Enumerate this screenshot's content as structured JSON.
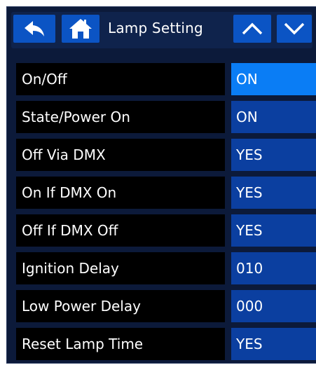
{
  "header": {
    "title": "Lamp Setting",
    "icons": {
      "back": "back-arrow-icon",
      "home": "home-icon",
      "up": "chevron-up-icon",
      "down": "chevron-down-icon"
    }
  },
  "colors": {
    "background": "#0c1a3a",
    "button": "#0b54c4",
    "value_cell": "#0b3fa0",
    "value_cell_selected": "#0a7df5",
    "label_cell": "#000000"
  },
  "rows": [
    {
      "label": "On/Off",
      "value": "ON",
      "selected": true
    },
    {
      "label": "State/Power On",
      "value": "ON",
      "selected": false
    },
    {
      "label": "Off Via DMX",
      "value": "YES",
      "selected": false
    },
    {
      "label": "On If DMX On",
      "value": "YES",
      "selected": false
    },
    {
      "label": "Off If DMX Off",
      "value": "YES",
      "selected": false
    },
    {
      "label": "Ignition Delay",
      "value": "010",
      "selected": false
    },
    {
      "label": "Low Power Delay",
      "value": "000",
      "selected": false
    },
    {
      "label": "Reset Lamp Time",
      "value": "YES",
      "selected": false
    }
  ]
}
